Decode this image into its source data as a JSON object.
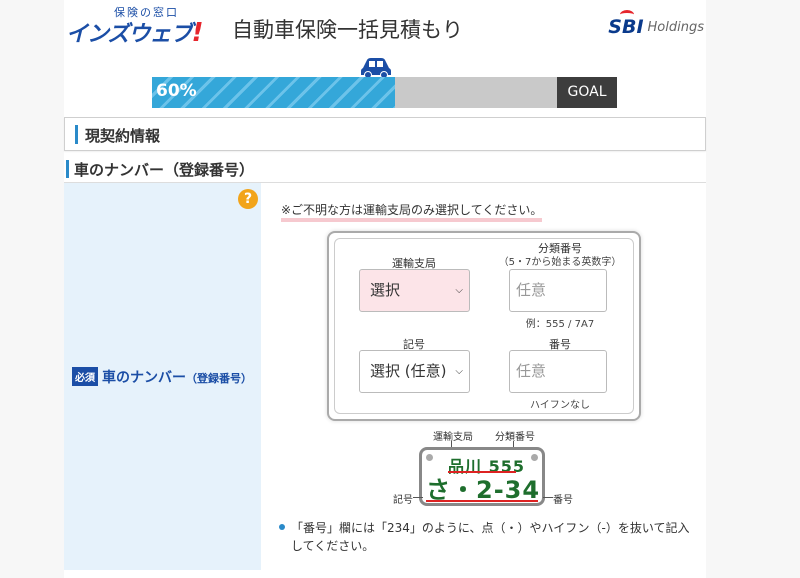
{
  "header": {
    "logo_small": "保険の窓口",
    "logo_main": "インズウェブ",
    "logo_bang": "!",
    "title": "自動車保険一括見積もり",
    "sbi_mark": "SBI",
    "sbi_holdings": "Holdings"
  },
  "progress": {
    "percent_label": "60%",
    "value_percent": 60,
    "goal_label": "GOAL",
    "fill_color": "#34a7d9",
    "car_color": "#1b4ea6"
  },
  "section": {
    "title": "現契約情報"
  },
  "subsection": {
    "title": "車のナンバー（登録番号）"
  },
  "field": {
    "required_badge": "必須",
    "label": "車のナンバー",
    "label_sub": "（登録番号）",
    "help_icon": "question-circle-icon",
    "notice": "※ご不明な方は運輸支局のみ選択してください。"
  },
  "form": {
    "bureau_label": "運輸支局",
    "bureau_value": "選択",
    "class_label": "分類番号",
    "class_sub": "（5・7から始まる英数字）",
    "class_placeholder": "任意",
    "class_example": "例：555 / 7A7",
    "kana_label": "記号",
    "kana_value": "選択 (任意)",
    "number_label": "番号",
    "number_placeholder": "任意",
    "number_hint": "ハイフンなし"
  },
  "plate": {
    "top_text": "品川 555",
    "bottom_text": "さ・2-34",
    "label_bureau": "運輸支局",
    "label_class": "分類番号",
    "label_kana": "記号",
    "label_number": "番号"
  },
  "note": "「番号」欄には「234」のように、点（・）やハイフン（-）を抜いて記入してください。"
}
